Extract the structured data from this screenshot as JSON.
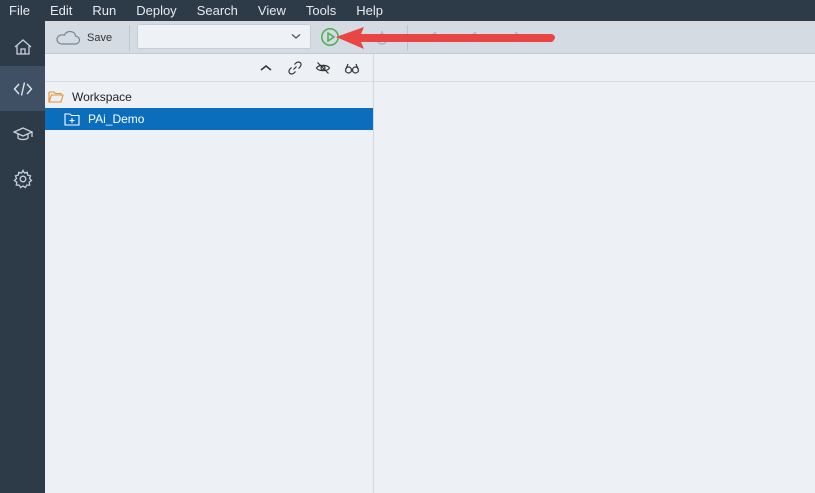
{
  "menu": [
    "File",
    "Edit",
    "Run",
    "Deploy",
    "Search",
    "View",
    "Tools",
    "Help"
  ],
  "sidebar": {
    "items": [
      {
        "name": "home-icon",
        "active": false
      },
      {
        "name": "code-icon",
        "active": true
      },
      {
        "name": "learning-icon",
        "active": false
      },
      {
        "name": "gear-icon",
        "active": false
      }
    ]
  },
  "toolbar": {
    "save_label": "Save",
    "run_config_value": "",
    "run_icon_color": "#4caf50"
  },
  "explorer": {
    "toolbar_icons": [
      "collapse-icon",
      "link-icon",
      "hide-icon",
      "glasses-icon"
    ],
    "tree": [
      {
        "label": "Workspace",
        "icon": "folder-open-icon",
        "selected": false,
        "indent": 0
      },
      {
        "label": "PAi_Demo",
        "icon": "project-folder-icon",
        "selected": true,
        "indent": 1
      }
    ]
  },
  "annotation": {
    "arrow_color": "#e94545"
  }
}
